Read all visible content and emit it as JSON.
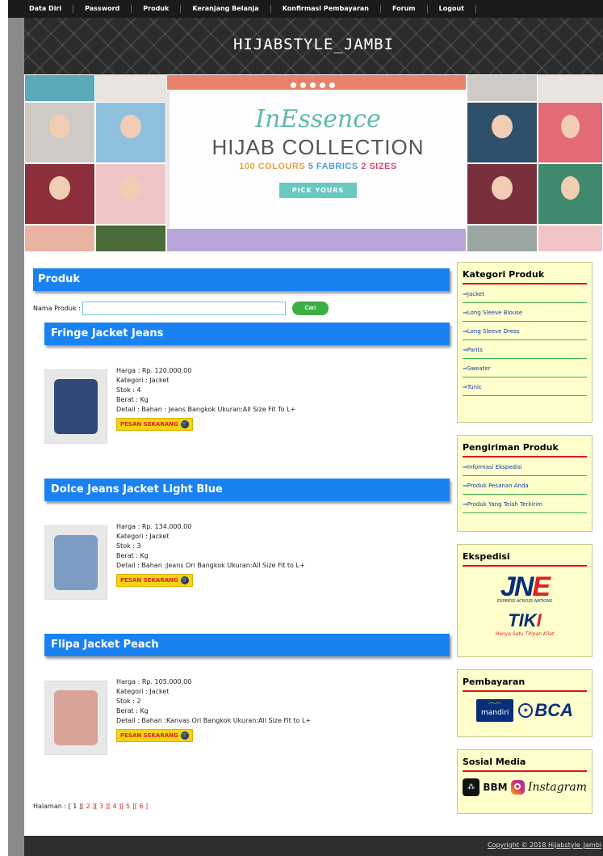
{
  "nav": {
    "items": [
      "Data Diri",
      "Password",
      "Produk",
      "Keranjang Belanja",
      "Konfirmasi Pembayaran",
      "Forum",
      "Logout"
    ]
  },
  "header": {
    "title": "HIJABSTYLE_JAMBI"
  },
  "banner": {
    "brand": "InEssence",
    "collection": "HIJAB COLLECTION",
    "tag_colours": "100 COLOURS",
    "tag_fabrics": "5 FABRICS",
    "tag_sizes": "2 SIZES",
    "cta": "PICK YOURS"
  },
  "main": {
    "section_title": "Produk",
    "search": {
      "label": "Nama Produk :",
      "value": "",
      "button": "Cari"
    },
    "order_button": {
      "text": "PESAN SEKARANG",
      "cart_glyph": "🛒"
    },
    "products": [
      {
        "name": "Fringe Jacket Jeans",
        "harga": "Harga : Rp. 120.000,00",
        "kategori": "Kategori : Jacket",
        "stok": "Stok : 4",
        "berat": "Berat : Kg",
        "detail": "Detail : Bahan : Jeans Bangkok Ukuran:All Size Fit To L+",
        "image_color": "#2f4a78"
      },
      {
        "name": "Dolce Jeans Jacket Light Blue",
        "harga": "Harga : Rp. 134.000,00",
        "kategori": "Kategori : Jacket",
        "stok": "Stok : 3",
        "berat": "Berat : Kg",
        "detail": "Detail : Bahan :Jeans Ori Bangkok Ukuran:All Size Fit to L+",
        "image_color": "#7d9cc4"
      },
      {
        "name": "Flipa Jacket Peach",
        "harga": "Harga : Rp. 105.000,00",
        "kategori": "Kategori : Jacket",
        "stok": "Stok : 2",
        "berat": "Berat : Kg",
        "detail": "Detail : Bahan :Kanvas Ori Bangkok Ukuran:All Size Fit to L+",
        "image_color": "#d8a49a"
      }
    ],
    "pagination": {
      "label": "Halaman :",
      "current": "[ 1 ]",
      "pages": [
        "[ 2 ]",
        "[ 3 ]",
        "[ 4 ]",
        "[ 5 ]",
        "[ 6 ]"
      ]
    }
  },
  "sidebar": {
    "kategori": {
      "title": "Kategori Produk",
      "items": [
        "Jacket",
        "Long Sleeve Blouse",
        "Long Sleeve Dress",
        "Pants",
        "Sweater",
        "Tunic"
      ]
    },
    "pengiriman": {
      "title": "Pengiriman Produk",
      "items": [
        "Informasi Ekspedisi",
        "Produk Pesanan Anda",
        "Produk Yang Telah Terkirim"
      ]
    },
    "ekspedisi": {
      "title": "Ekspedisi",
      "jne_logo": "JNE",
      "jne_tagline": "EXPRESS ACROSS NATIONS",
      "tiki_logo": "TIKI",
      "tiki_tagline": "Hanya Satu Titipan Kilat"
    },
    "pembayaran": {
      "title": "Pembayaran",
      "mandiri_logo": "mandiri",
      "bca_logo": "BCA"
    },
    "sosial": {
      "title": "Sosial Media",
      "bbm_label": "BBM",
      "instagram_label": "Instagram"
    }
  },
  "footer": {
    "copyright": "Copyright © 2018 Hijabstyle_Jambi"
  },
  "colors": {
    "bar_blue": "#1a82f0",
    "accent_red": "#e0141c",
    "sidebar_bg": "#ffffcc",
    "nav_bg": "#1a1a1a"
  }
}
